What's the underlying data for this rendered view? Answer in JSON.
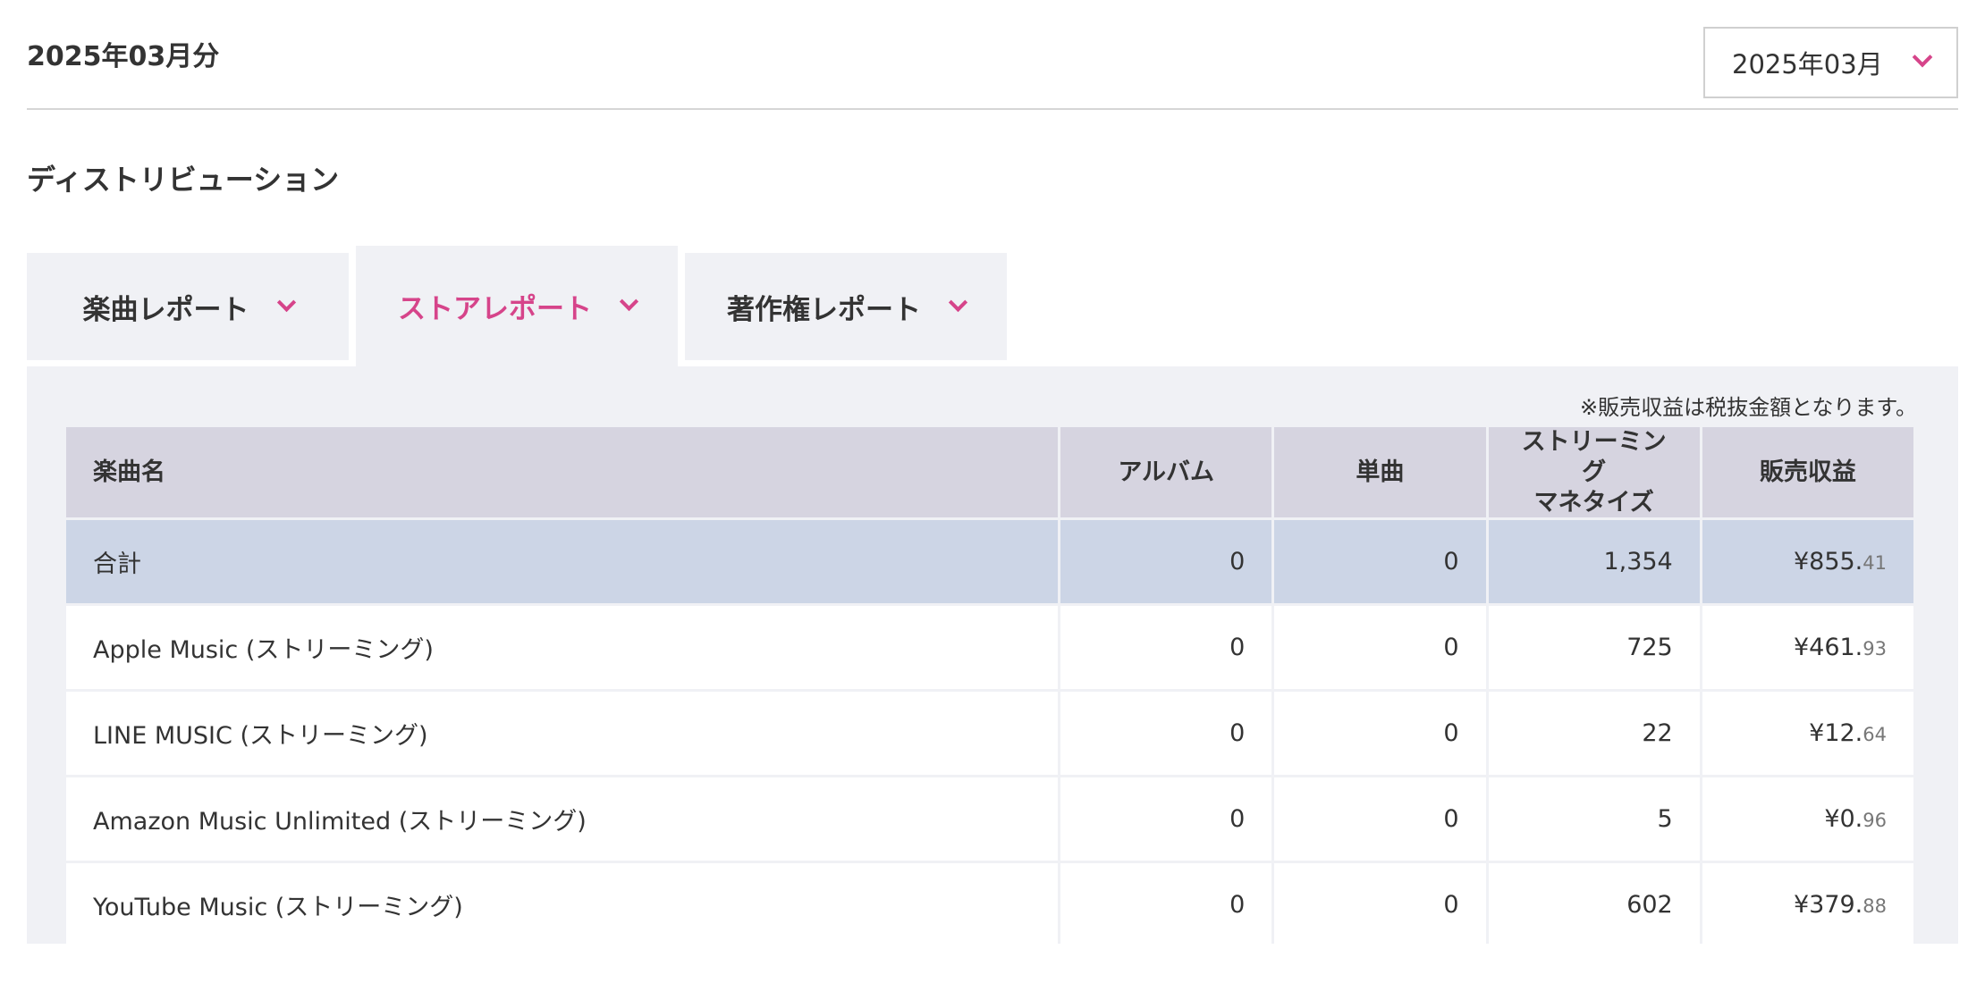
{
  "header": {
    "title": "2025年03月分",
    "month_select": {
      "value": "2025年03月"
    }
  },
  "section": {
    "title": "ディストリビューション"
  },
  "tabs": [
    {
      "label": "楽曲レポート",
      "active": false
    },
    {
      "label": "ストアレポート",
      "active": true
    },
    {
      "label": "著作権レポート",
      "active": false
    }
  ],
  "panel": {
    "note": "※販売収益は税抜金額となります。"
  },
  "table": {
    "columns": {
      "name": "楽曲名",
      "album": "アルバム",
      "single": "単曲",
      "streaming_line1": "ストリーミング",
      "streaming_line2": "マネタイズ",
      "revenue": "販売収益"
    },
    "rows": [
      {
        "name": "合計",
        "album": "0",
        "single": "0",
        "streaming": "1,354",
        "revenue_main": "¥855.",
        "revenue_cents": "41"
      },
      {
        "name": "Apple Music (ストリーミング)",
        "album": "0",
        "single": "0",
        "streaming": "725",
        "revenue_main": "¥461.",
        "revenue_cents": "93"
      },
      {
        "name": "LINE MUSIC (ストリーミング)",
        "album": "0",
        "single": "0",
        "streaming": "22",
        "revenue_main": "¥12.",
        "revenue_cents": "64"
      },
      {
        "name": "Amazon Music Unlimited (ストリーミング)",
        "album": "0",
        "single": "0",
        "streaming": "5",
        "revenue_main": "¥0.",
        "revenue_cents": "96"
      },
      {
        "name": "YouTube Music (ストリーミング)",
        "album": "0",
        "single": "0",
        "streaming": "602",
        "revenue_main": "¥379.",
        "revenue_cents": "88"
      }
    ]
  },
  "colors": {
    "accent": "#d6448a",
    "header_row": "#d6d4e0",
    "total_row": "#ccd5e6",
    "panel_bg": "#f0f1f5"
  },
  "icons": {
    "select_chevron": "chevron-down-icon",
    "tab_chevron": "chevron-down-icon"
  }
}
